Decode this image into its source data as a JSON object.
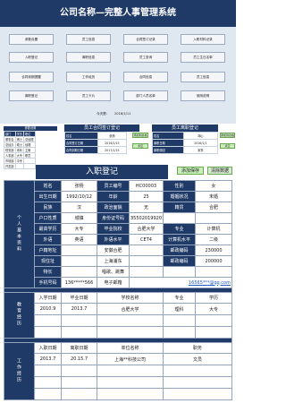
{
  "title": "公司名称—完整人事管理系统",
  "nav": {
    "row1": [
      "参数设置",
      "员工信息",
      "合同签订记录",
      "入职材料记录"
    ],
    "row2": [
      "入职登记",
      "离职信息",
      "员工查询",
      "员工生日名单"
    ],
    "row3": [
      "合同到期提醒",
      "工作经历",
      "合同信息",
      "员工信息"
    ],
    "row4": [
      "离职登记",
      "员工卡片",
      "部门人员名单",
      "使用说明"
    ]
  },
  "today": {
    "label": "今天是：",
    "value": "2018/1/11"
  },
  "mini_param": {
    "title": "参数设置",
    "rows": [
      [
        "部门",
        "学历",
        "职位"
      ],
      [
        "董事会",
        "博士",
        "总经理"
      ],
      [
        "总经办",
        "硕士",
        "经理"
      ],
      [
        "财务部",
        "本科",
        "主管"
      ],
      [
        "人事部",
        "大专",
        "职员"
      ],
      [
        "市场部",
        "中专",
        ""
      ],
      [
        "开发部",
        "",
        ""
      ]
    ]
  },
  "mini_contract": {
    "title": "员工合同签订登记",
    "rows": [
      [
        "姓名",
        "张杨"
      ],
      [
        "合同签订日期",
        "2016/1/15"
      ],
      [
        "合同到期日期",
        "2017/1/15"
      ]
    ],
    "btn1": "添加到表格",
    "btn2": "清空"
  },
  "mini_leave": {
    "title": "员工离职登记",
    "rows": [
      [
        "姓名",
        "胡心"
      ],
      [
        "离职日期",
        "2016/1/1"
      ],
      [
        "离职原因",
        "家事"
      ]
    ],
    "btn1": "添加到表格",
    "btn2": "清空"
  },
  "entry": {
    "title": "入职登记",
    "add_btn": "添加保存",
    "clear_btn": "清除数据",
    "side_label": "个人基本资料",
    "personal": [
      [
        "姓名",
        "张杨",
        "员工编号",
        "HC00003",
        "性别",
        "女"
      ],
      [
        "出生日期",
        "1992/10/12",
        "年龄",
        "25",
        "婚姻状况",
        "未婚"
      ],
      [
        "民族",
        "汉",
        "政治面貌",
        "无",
        "籍贯",
        "合肥"
      ],
      [
        "户口性质",
        "城镇",
        "身份证号码",
        "35502019920101****",
        "",
        ""
      ],
      [
        "最高学历",
        "大专",
        "毕业院校",
        "合肥大学",
        "专业",
        "计算机"
      ],
      [
        "外语",
        "英语",
        "外语水平",
        "CET4",
        "计算机水平",
        "二级"
      ],
      [
        "户籍地址",
        "",
        "安徽合肥",
        "",
        "邮政编码",
        "230000"
      ],
      [
        "现住址",
        "",
        "上海浦东",
        "",
        "邮政编码",
        "200000"
      ],
      [
        "特长",
        "",
        "唱歌、跳舞",
        "",
        "",
        ""
      ]
    ],
    "phone_label": "手机号码",
    "phone_value": "136*****566",
    "email_label": "电子邮箱",
    "email_value": "16565***@qq.com",
    "edu_label": "教育经历",
    "edu_head": [
      "入学日期",
      "毕业日期",
      "学校名称",
      "专业",
      "学历"
    ],
    "edu_rows": [
      [
        "2010.9",
        "2013.7",
        "合肥大学",
        "理科",
        "大专"
      ],
      [
        "",
        "",
        "",
        "",
        ""
      ],
      [
        "",
        "",
        "",
        "",
        ""
      ]
    ],
    "work_label": "工作经历",
    "work_head": [
      "入职日期",
      "离职日期",
      "单位名称",
      "职务"
    ],
    "work_rows": [
      [
        "2013.7",
        "20.15.7",
        "上海**科技公司",
        "文员"
      ],
      [
        "",
        "",
        "",
        ""
      ],
      [
        "",
        "",
        "",
        ""
      ],
      [
        "",
        "",
        "",
        ""
      ]
    ]
  }
}
